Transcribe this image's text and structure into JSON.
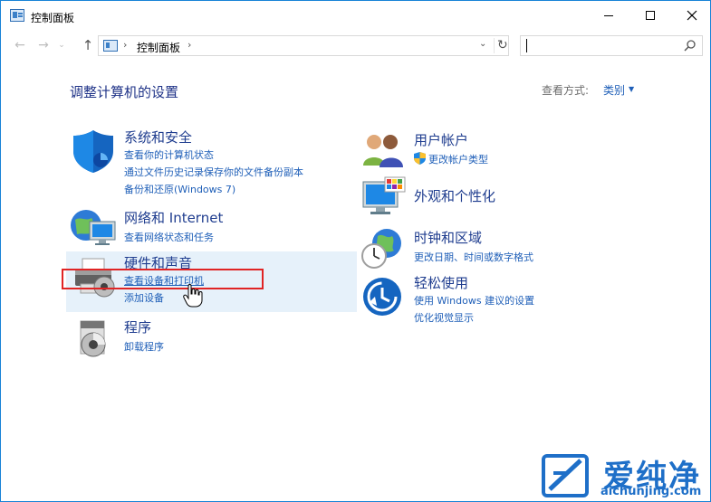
{
  "window": {
    "title": "控制面板"
  },
  "nav": {
    "back_glyph": "←",
    "forward_glyph": "→",
    "recent_glyph": "⌄",
    "up_glyph": "↑",
    "breadcrumb_sep": "›",
    "breadcrumb": "控制面板",
    "dropdown_glyph": "⌄",
    "refresh_glyph": "↻",
    "search_placeholder": ""
  },
  "main": {
    "heading": "调整计算机的设置",
    "view_by_label": "查看方式:",
    "view_by_value": "类别",
    "view_by_caret": "▼"
  },
  "categories": {
    "system_security": {
      "title": "系统和安全",
      "links": [
        "查看你的计算机状态",
        "通过文件历史记录保存你的文件备份副本",
        "备份和还原(Windows 7)"
      ],
      "icon": "shield-icon"
    },
    "network": {
      "title": "网络和 Internet",
      "links": [
        "查看网络状态和任务"
      ],
      "icon": "network-globe-icon"
    },
    "hardware_sound": {
      "title": "硬件和声音",
      "links": [
        "查看设备和打印机",
        "添加设备"
      ],
      "icon": "printer-icon"
    },
    "programs": {
      "title": "程序",
      "links": [
        "卸载程序"
      ],
      "icon": "programs-disc-icon"
    },
    "user_accounts": {
      "title": "用户帐户",
      "links": [
        "更改帐户类型"
      ],
      "icon": "users-icon"
    },
    "appearance": {
      "title": "外观和个性化",
      "links": [],
      "icon": "monitor-palette-icon"
    },
    "clock_region": {
      "title": "时钟和区域",
      "links": [
        "更改日期、时间或数字格式"
      ],
      "icon": "clock-globe-icon"
    },
    "ease_access": {
      "title": "轻松使用",
      "links": [
        "使用 Windows 建议的设置",
        "优化视觉显示"
      ],
      "icon": "ease-of-access-icon"
    }
  },
  "watermark": {
    "brand": "爱纯净",
    "url": "aichunjing.com"
  },
  "colors": {
    "accent_border": "#1883d7",
    "link": "#1f5fb8",
    "title": "#1f3d8f",
    "hover": "#e6f1fa",
    "highlight_box": "#e02424"
  }
}
